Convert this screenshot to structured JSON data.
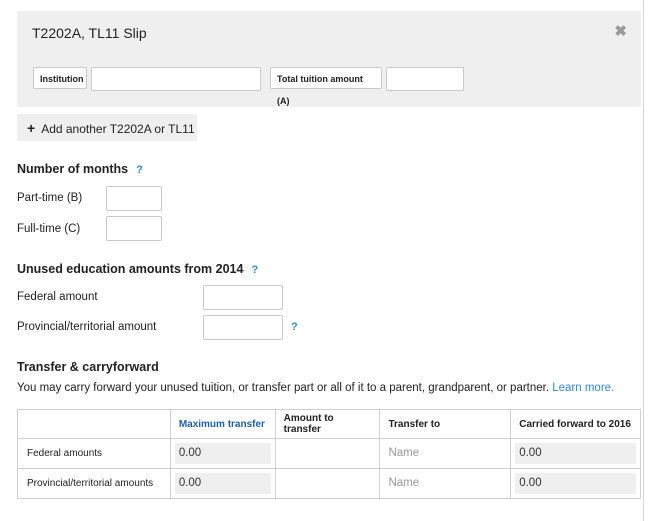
{
  "slip": {
    "title": "T2202A, TL11 Slip",
    "close_icon": "close-x-icon",
    "institution_label": "Institution",
    "institution_value": "",
    "tuition_label": "Total tuition amount (A)",
    "tuition_value": ""
  },
  "add_button": {
    "icon": "plus-icon",
    "label": "Add another T2202A or TL11"
  },
  "months": {
    "heading": "Number of months",
    "help": "?",
    "part_time_label": "Part-time (B)",
    "part_time_value": "",
    "full_time_label": "Full-time (C)",
    "full_time_value": ""
  },
  "unused": {
    "heading": "Unused education amounts from 2014",
    "help": "?",
    "federal_label": "Federal amount",
    "federal_value": "",
    "provincial_label": "Provincial/territorial amount",
    "provincial_value": "",
    "provincial_help": "?"
  },
  "transfer": {
    "heading": "Transfer & carryforward",
    "description": "You may carry forward your unused tuition, or transfer part or all of it to a parent, grandparent, or partner. ",
    "learn_more": "Learn more.",
    "columns": [
      "",
      "Maximum transfer",
      "Amount to transfer",
      "Transfer to",
      "Carried forward to 2016"
    ],
    "rows": [
      {
        "label": "Federal amounts",
        "max_transfer": "0.00",
        "amount": "",
        "transfer_to": "Name",
        "carried": "0.00"
      },
      {
        "label": "Provincial/territorial amounts",
        "max_transfer": "0.00",
        "amount": "",
        "transfer_to": "Name",
        "carried": "0.00"
      }
    ]
  },
  "colors": {
    "accent": "#2e8ad8",
    "header_blue": "#1f62a8",
    "panel": "#efefef"
  }
}
